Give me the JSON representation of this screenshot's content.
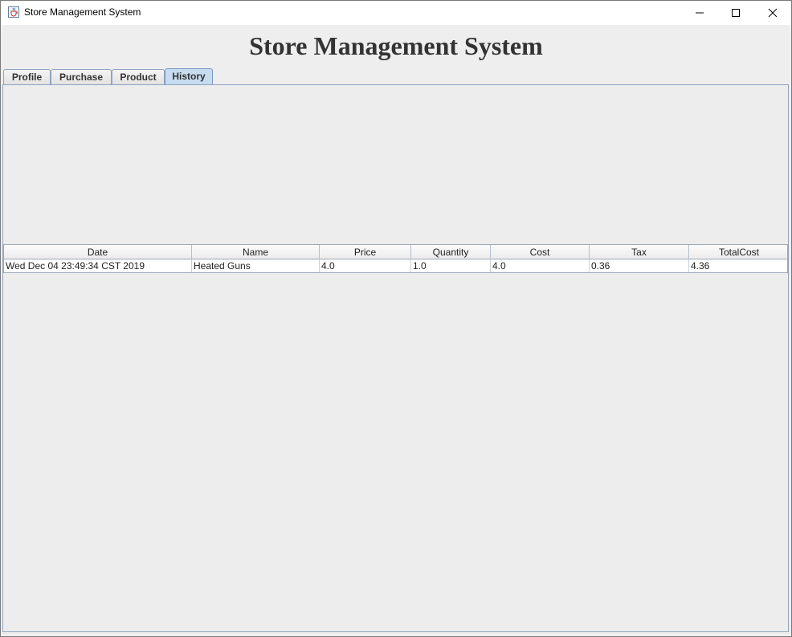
{
  "window": {
    "title": "Store Management System"
  },
  "app": {
    "heading": "Store Management System"
  },
  "tabs": [
    {
      "label": "Profile"
    },
    {
      "label": "Purchase"
    },
    {
      "label": "Product"
    },
    {
      "label": "History"
    }
  ],
  "active_tab": "History",
  "history_table": {
    "columns": [
      "Date",
      "Name",
      "Price",
      "Quantity",
      "Cost",
      "Tax",
      "TotalCost"
    ],
    "rows": [
      [
        "Wed Dec 04 23:49:34 CST 2019",
        "Heated Guns",
        "4.0",
        "1.0",
        "4.0",
        "0.36",
        "4.36"
      ]
    ]
  },
  "colors": {
    "active_tab": "#c8dcf0",
    "tab_border": "#8ea3bf",
    "heading": "#333333",
    "background": "#eeeeee"
  },
  "icons": {
    "app": "java-cup-icon",
    "minimize": "minimize-icon",
    "maximize": "maximize-icon",
    "close": "close-icon"
  }
}
